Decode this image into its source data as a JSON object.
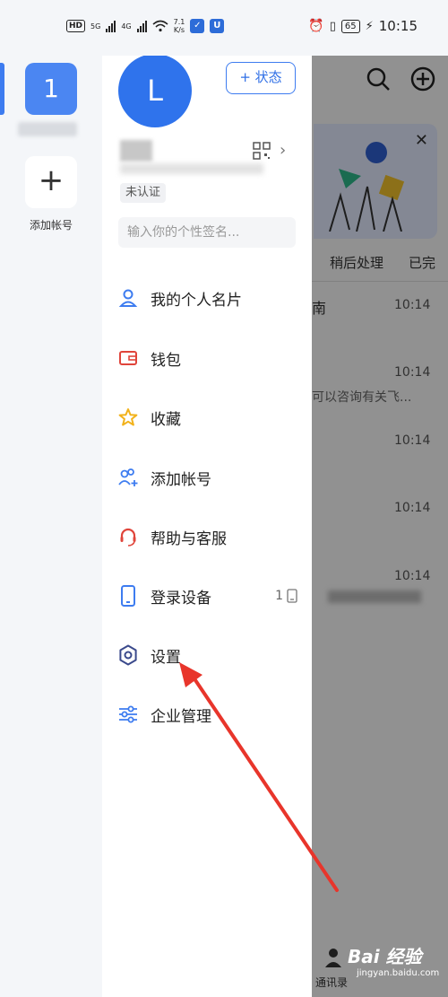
{
  "status_bar": {
    "left_chip1": "HD",
    "left_net1": "5G",
    "left_net2": "4G",
    "speed_value": "7.1",
    "speed_unit": "K/s",
    "battery": "65",
    "time": "10:15"
  },
  "account_strip": {
    "active_account_label": "1",
    "add_account_symbol": "+",
    "add_account_label": "添加帐号"
  },
  "profile": {
    "avatar_letter": "L",
    "status_button": "+ 状态",
    "unverified_badge": "未认证",
    "signature_placeholder": "输入你的个性签名..."
  },
  "menu": [
    {
      "id": "card",
      "label": "我的个人名片",
      "icon": "person-card-icon",
      "color": "#3d7cf0"
    },
    {
      "id": "wallet",
      "label": "钱包",
      "icon": "wallet-icon",
      "color": "#e0453b"
    },
    {
      "id": "favorites",
      "label": "收藏",
      "icon": "star-icon",
      "color": "#f2b21b"
    },
    {
      "id": "add-account",
      "label": "添加帐号",
      "icon": "add-people-icon",
      "color": "#3d7cf0"
    },
    {
      "id": "help",
      "label": "帮助与客服",
      "icon": "headset-icon",
      "color": "#e0453b"
    },
    {
      "id": "devices",
      "label": "登录设备",
      "icon": "phone-icon",
      "color": "#3d7cf0",
      "extra": "1"
    },
    {
      "id": "settings",
      "label": "设置",
      "icon": "gear-icon",
      "color": "#3b4a8c"
    },
    {
      "id": "enterprise",
      "label": "企业管理",
      "icon": "sliders-icon",
      "color": "#3d7cf0"
    }
  ],
  "background_app": {
    "tabs": [
      "稍后处理",
      "已完"
    ],
    "rows": [
      {
        "title": "南",
        "time": "10:14"
      },
      {
        "preview": "可以咨询有关飞...",
        "time": "10:14"
      },
      {
        "time": "10:14"
      },
      {
        "time": "10:14"
      },
      {
        "time": "10:14"
      }
    ],
    "bottom_label": "通讯录"
  },
  "watermark": {
    "main": "Bai 经验",
    "sub": "jingyan.baidu.com"
  },
  "colors": {
    "accent": "#3d7cf0",
    "arrow": "#e8352b"
  }
}
